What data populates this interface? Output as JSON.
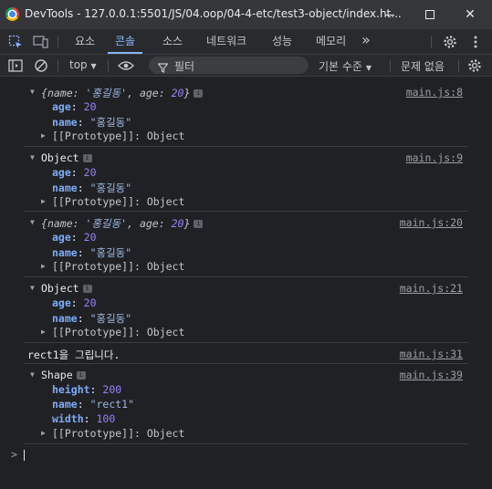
{
  "window": {
    "title": "DevTools - 127.0.0.1:5501/JS/04.oop/04-4-etc/test3-object/index.ht...",
    "minimize_icon": "minimize-icon",
    "maximize_icon": "maximize-icon",
    "close_label": "✕"
  },
  "tabs": {
    "items": [
      {
        "label": "요소"
      },
      {
        "label": "콘솔"
      },
      {
        "label": "소스"
      },
      {
        "label": "네트워크"
      },
      {
        "label": "성능"
      },
      {
        "label": "메모리"
      }
    ],
    "more_label": "»",
    "active_index": 1
  },
  "toolbar": {
    "context": "top",
    "filter_placeholder": "필터",
    "levels": "기본 수준",
    "issues": "문제 없음"
  },
  "console": {
    "entries": [
      {
        "summary_open": "{",
        "summary_k1": "name",
        "summary_v1": "'홍길동'",
        "summary_k2": "age",
        "summary_v2": "20",
        "summary_close": "}",
        "age_key": "age",
        "age_val": "20",
        "name_key": "name",
        "name_val": "\"홍길동\"",
        "proto": "[[Prototype]]: Object",
        "source": "main.js:8"
      },
      {
        "summary": "Object",
        "age_key": "age",
        "age_val": "20",
        "name_key": "name",
        "name_val": "\"홍길동\"",
        "proto": "[[Prototype]]: Object",
        "source": "main.js:9"
      },
      {
        "summary_open": "{",
        "summary_k1": "name",
        "summary_v1": "'홍길동'",
        "summary_k2": "age",
        "summary_v2": "20",
        "summary_close": "}",
        "age_key": "age",
        "age_val": "20",
        "name_key": "name",
        "name_val": "\"홍길동\"",
        "proto": "[[Prototype]]: Object",
        "source": "main.js:20"
      },
      {
        "summary": "Object",
        "age_key": "age",
        "age_val": "20",
        "name_key": "name",
        "name_val": "\"홍길동\"",
        "proto": "[[Prototype]]: Object",
        "source": "main.js:21"
      },
      {
        "message": "rect1을 그립니다.",
        "source": "main.js:31"
      },
      {
        "summary": "Shape",
        "height_key": "height",
        "height_val": "200",
        "name_key": "name",
        "name_val": "\"rect1\"",
        "width_key": "width",
        "width_val": "100",
        "proto": "[[Prototype]]: Object",
        "source": "main.js:39"
      }
    ],
    "prompt": ">"
  },
  "colors": {
    "background": "#202124",
    "accent": "#8ab4f8",
    "property_key": "#7cacf8",
    "number": "#9980ff"
  }
}
